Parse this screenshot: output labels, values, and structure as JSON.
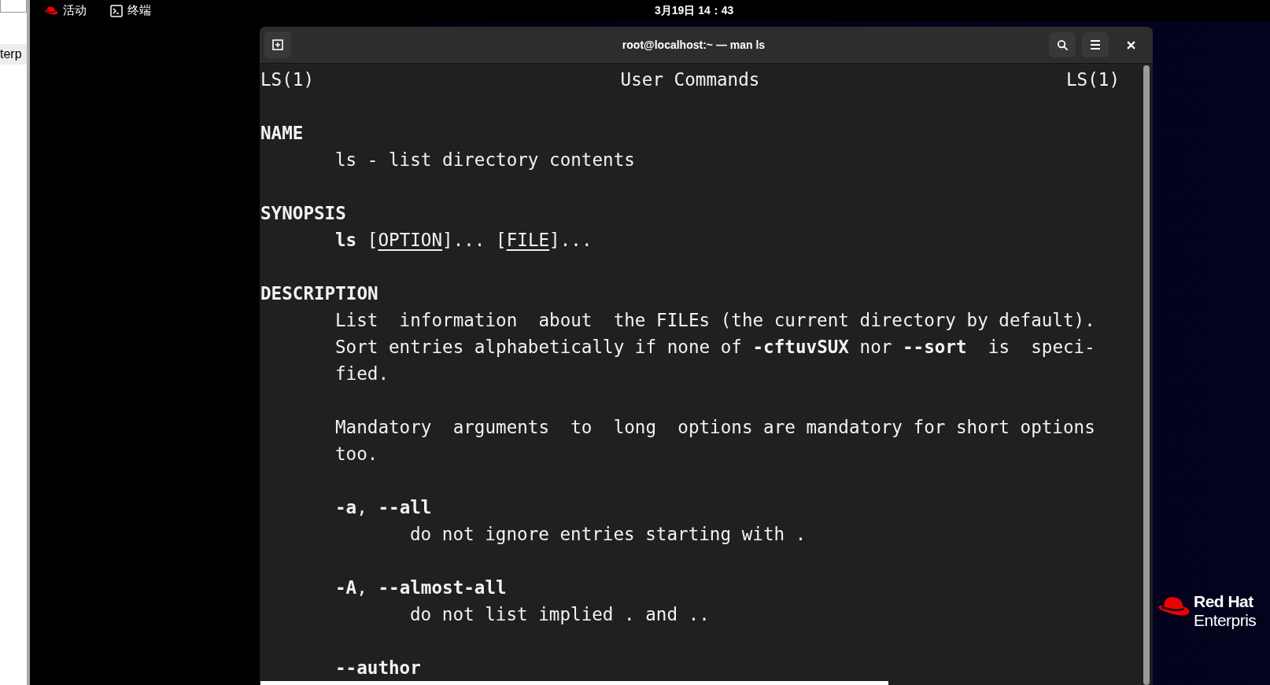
{
  "side_window": {
    "text": "terp"
  },
  "top_bar": {
    "activities": "活动",
    "app": "终端",
    "clock": "3月19日 14：43"
  },
  "terminal": {
    "title": "root@localhost:~ — man ls",
    "man_header": {
      "left": "LS(1)",
      "center": "User Commands",
      "right": "LS(1)"
    },
    "sections": [
      {
        "heading": "NAME",
        "paragraphs": [
          {
            "lines": [
              [
                {
                  "text": "ls - list directory contents",
                  "kind": "plain"
                }
              ]
            ]
          }
        ]
      },
      {
        "heading": "SYNOPSIS",
        "paragraphs": [
          {
            "lines": [
              [
                {
                  "text": "ls",
                  "kind": "bold"
                },
                {
                  "text": " [",
                  "kind": "plain"
                },
                {
                  "text": "OPTION",
                  "kind": "underline"
                },
                {
                  "text": "]... [",
                  "kind": "plain"
                },
                {
                  "text": "FILE",
                  "kind": "underline"
                },
                {
                  "text": "]...",
                  "kind": "plain"
                }
              ]
            ]
          }
        ]
      },
      {
        "heading": "DESCRIPTION",
        "paragraphs": [
          {
            "lines": [
              [
                {
                  "text": "List  information  about  the FILEs (the current directory by default).",
                  "kind": "plain"
                }
              ],
              [
                {
                  "text": "Sort entries alphabetically if none of ",
                  "kind": "plain"
                },
                {
                  "text": "-cftuvSUX",
                  "kind": "bold"
                },
                {
                  "text": " nor ",
                  "kind": "plain"
                },
                {
                  "text": "--sort",
                  "kind": "bold"
                },
                {
                  "text": "  is  speci-",
                  "kind": "plain"
                }
              ],
              [
                {
                  "text": "fied.",
                  "kind": "plain"
                }
              ]
            ]
          },
          {
            "lines": [
              [
                {
                  "text": "Mandatory  arguments  to  long  options are mandatory for short options",
                  "kind": "plain"
                }
              ],
              [
                {
                  "text": "too.",
                  "kind": "plain"
                }
              ]
            ]
          }
        ],
        "options": [
          {
            "term": [
              {
                "text": "-a",
                "kind": "bold"
              },
              {
                "text": ", ",
                "kind": "plain"
              },
              {
                "text": "--all",
                "kind": "bold"
              }
            ],
            "paragraphs": [
              {
                "lines": [
                  [
                    {
                      "text": "do not ignore entries starting with .",
                      "kind": "plain"
                    }
                  ]
                ]
              }
            ]
          },
          {
            "term": [
              {
                "text": "-A",
                "kind": "bold"
              },
              {
                "text": ", ",
                "kind": "plain"
              },
              {
                "text": "--almost-all",
                "kind": "bold"
              }
            ],
            "paragraphs": [
              {
                "lines": [
                  [
                    {
                      "text": "do not list implied . and ..",
                      "kind": "plain"
                    }
                  ]
                ]
              }
            ]
          },
          {
            "term": [
              {
                "text": "--author",
                "kind": "bold"
              }
            ]
          }
        ]
      }
    ]
  },
  "brand": {
    "line_1": "Red Hat",
    "line_2": "Enterpris"
  }
}
